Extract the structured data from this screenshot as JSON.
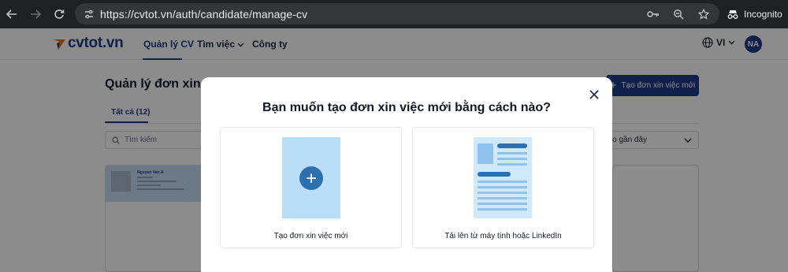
{
  "browser": {
    "url": "https://cvtot.vn/auth/candidate/manage-cv",
    "incognito_label": "Incognito"
  },
  "site": {
    "logo_text": "cvtot.vn",
    "nav": [
      "Quản lý CV",
      "Tìm việc",
      "Công ty"
    ],
    "language": "VI",
    "avatar_initials": "NA"
  },
  "page": {
    "title": "Quản lý đơn xin việ",
    "create_button": "Tạo đơn xin việc mới",
    "tab_all": "Tất cả (12)",
    "search_placeholder": "Tìm kiếm",
    "sort_label": "c tạo gần đây",
    "cv_name": "Nguyen Van A"
  },
  "modal": {
    "title": "Bạn muốn tạo đơn xin việc mới bằng cách nào?",
    "option_new": "Tạo đơn xin việc mới",
    "option_upload": "Tải lên từ máy tính hoặc LinkedIn"
  },
  "colors": {
    "brand": "#1e3a8a",
    "accent": "#2f6fae",
    "logo_arrow": "#ef6c00"
  }
}
